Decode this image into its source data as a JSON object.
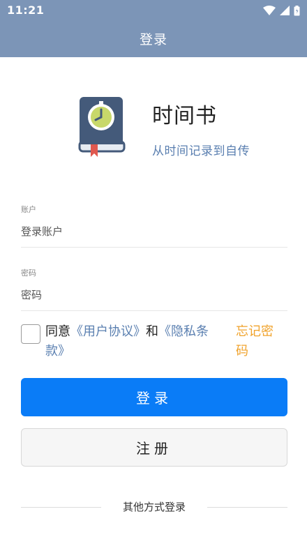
{
  "status_bar": {
    "time": "11:21",
    "icons": [
      "wifi-icon",
      "signal-icon",
      "battery-icon"
    ]
  },
  "app_bar": {
    "title": "登录"
  },
  "branding": {
    "app_name": "时间书",
    "slogan": "从时间记录到自传",
    "logo_icon": "book-clock-logo"
  },
  "form": {
    "account": {
      "label": "账户",
      "placeholder": "登录账户",
      "value": ""
    },
    "password": {
      "label": "密码",
      "placeholder": "密码",
      "value": ""
    },
    "agreement": {
      "checked": false,
      "prefix": "同意",
      "user_agreement": "《用户协议》",
      "and": "和",
      "privacy_policy": "《隐私条款》"
    },
    "forgot_password": "忘记密码"
  },
  "buttons": {
    "login": "登录",
    "register": "注册"
  },
  "other_login": {
    "label": "其他方式登录"
  },
  "colors": {
    "app_bar": "#7c95b7",
    "primary_button": "#0a7cf7",
    "link": "#5a7fb0",
    "forgot": "#f0a32c"
  }
}
